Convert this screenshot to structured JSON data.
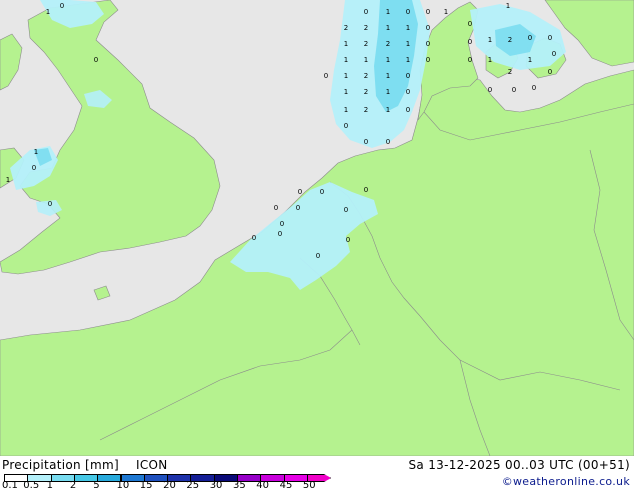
{
  "legend": {
    "title": "Precipitation [mm]",
    "model": "ICON",
    "levels": [
      {
        "label": "0.1",
        "color": "#ffffff"
      },
      {
        "label": "0.5",
        "color": "#b4f0fa"
      },
      {
        "label": "1",
        "color": "#78dcf0"
      },
      {
        "label": "2",
        "color": "#46c8e6"
      },
      {
        "label": "5",
        "color": "#28aadc"
      },
      {
        "label": "10",
        "color": "#1e78d2"
      },
      {
        "label": "15",
        "color": "#1e50be"
      },
      {
        "label": "20",
        "color": "#1e32aa"
      },
      {
        "label": "25",
        "color": "#141e96"
      },
      {
        "label": "30",
        "color": "#0a0a78"
      },
      {
        "label": "35",
        "color": "#9600c8"
      },
      {
        "label": "40",
        "color": "#c800dc"
      },
      {
        "label": "45",
        "color": "#e600e6"
      },
      {
        "label": "50",
        "color": "#f000c8"
      }
    ]
  },
  "valid_time": "Sa 13-12-2025 00..03 UTC (00+51)",
  "credit": "©weatheronline.co.uk",
  "colors": {
    "land": "#b5f28f",
    "sea": "#e7e7e7",
    "precip_light": "#b4f0fa",
    "precip_medium": "#78dcf0",
    "border": "#8c8c8c"
  },
  "map_labels": [
    "0",
    "1",
    "0",
    "1",
    "0",
    "0",
    "1",
    "2",
    "2",
    "1",
    "1",
    "0",
    "1",
    "2",
    "2",
    "1",
    "0",
    "1",
    "1",
    "1",
    "1",
    "0",
    "1",
    "2",
    "1",
    "0",
    "0",
    "1",
    "2",
    "1",
    "0",
    "1",
    "2",
    "1",
    "0",
    "0",
    "0",
    "0",
    "1",
    "0",
    "1",
    "2",
    "0",
    "0",
    "0",
    "0",
    "1",
    "2",
    "1",
    "0",
    "0",
    "0",
    "0",
    "0",
    "1",
    "0",
    "1",
    "0",
    "0",
    "0",
    "0",
    "0",
    "0",
    "0",
    "0",
    "0",
    "0",
    "0",
    "0",
    "0",
    "0",
    "0"
  ]
}
